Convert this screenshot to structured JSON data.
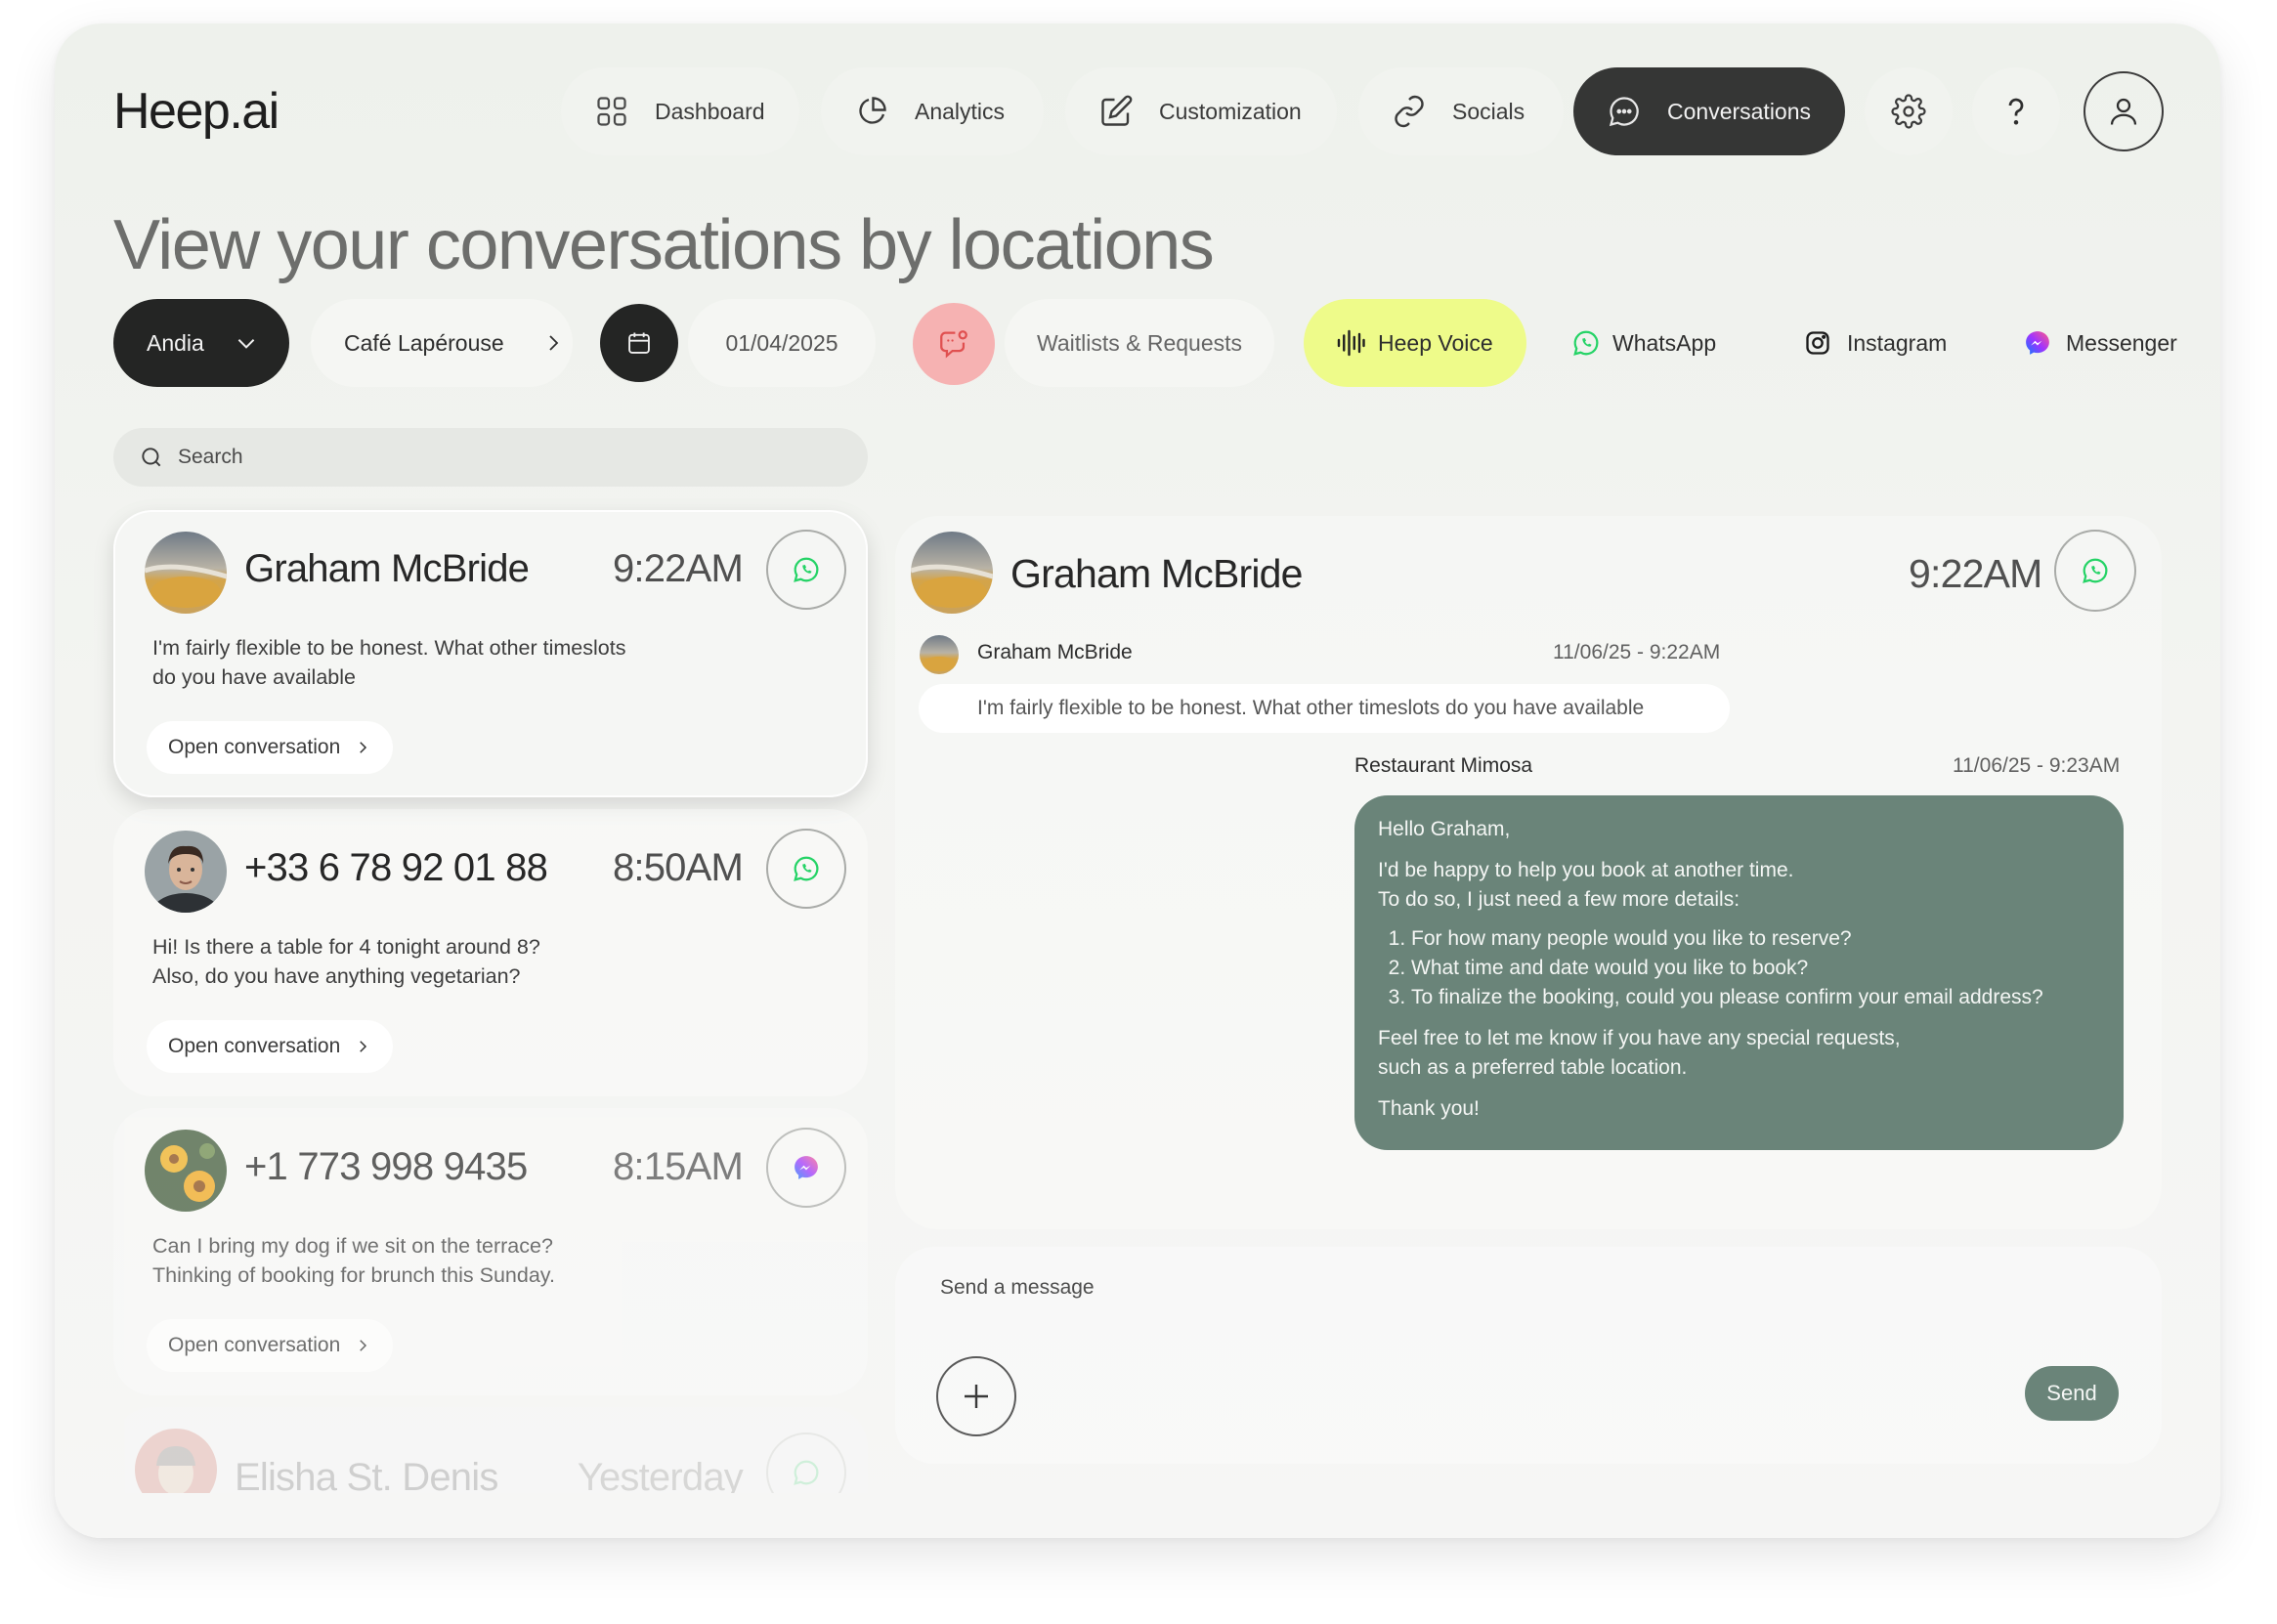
{
  "app": {
    "logo": "Heep.ai"
  },
  "nav": {
    "items": [
      {
        "label": "Dashboard",
        "icon": "grid-icon"
      },
      {
        "label": "Analytics",
        "icon": "pie-chart-icon"
      },
      {
        "label": "Customization",
        "icon": "edit-icon"
      },
      {
        "label": "Socials",
        "icon": "link-icon"
      },
      {
        "label": "Conversations",
        "icon": "chat-bubble-icon",
        "active": true
      }
    ],
    "settings_icon": "gear-icon",
    "help_icon": "question-icon",
    "profile_icon": "user-icon"
  },
  "page": {
    "title": "View your conversations by locations"
  },
  "filters": {
    "region": "Andia",
    "location": "Café Lapérouse",
    "date": "01/04/2025",
    "waitlists": "Waitlists & Requests",
    "heep_voice": "Heep Voice",
    "whatsapp": "WhatsApp",
    "instagram": "Instagram",
    "messenger": "Messenger"
  },
  "search": {
    "placeholder": "Search"
  },
  "conversations": [
    {
      "name": "Graham McBride",
      "time": "9:22AM",
      "channel": "whatsapp",
      "line1": "I'm fairly flexible to be honest. What other timeslots",
      "line2": "do you have available",
      "open_label": "Open conversation"
    },
    {
      "name": "+33 6 78 92 01 88",
      "time": "8:50AM",
      "channel": "whatsapp",
      "line1": "Hi! Is there a table for 4 tonight around 8?",
      "line2": "Also, do you have anything vegetarian?",
      "open_label": "Open conversation"
    },
    {
      "name": "+1 773 998 9435",
      "time": "8:15AM",
      "channel": "messenger",
      "line1": "Can I bring my dog if we sit on the terrace?",
      "line2": "Thinking of booking for brunch this Sunday.",
      "open_label": "Open conversation"
    },
    {
      "name": "Elisha St. Denis",
      "time": "Yesterday",
      "channel": "whatsapp"
    }
  ],
  "thread": {
    "contact_name": "Graham McBride",
    "time": "9:22AM",
    "incoming": {
      "sender": "Graham McBride",
      "timestamp": "11/06/25 - 9:22AM",
      "text": "I'm fairly flexible to be honest. What other timeslots do you have available"
    },
    "outgoing": {
      "sender": "Restaurant Mimosa",
      "timestamp": "11/06/25 - 9:23AM",
      "greeting": "Hello Graham,",
      "intro1": "I'd be happy to help you book at another time.",
      "intro2": "To do so, I just need a few more details:",
      "q1": "For how many people would you like to reserve?",
      "q2": "What time and date would you like to book?",
      "q3": "To finalize the booking, could you please confirm your email address?",
      "outro1": "Feel free to let me know if you have any special requests,",
      "outro2": "such as a preferred table location.",
      "thanks": "Thank you!"
    }
  },
  "composer": {
    "placeholder": "Send a message",
    "send_label": "Send"
  },
  "colors": {
    "accent_green": "#6a8479",
    "dark": "#353635",
    "heep_voice": "#eefb8a",
    "waitlist_icon_bg": "#f6b2b2",
    "whatsapp": "#25d366"
  }
}
